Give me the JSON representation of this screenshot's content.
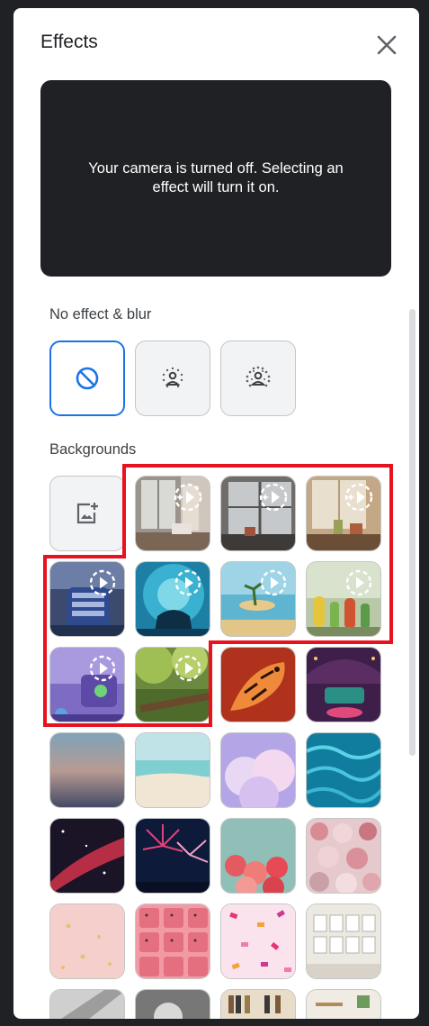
{
  "header": {
    "title": "Effects",
    "close_icon": "close-icon"
  },
  "preview": {
    "message": "Your camera is turned off. Selecting an effect will turn it on."
  },
  "sections": {
    "blur_title": "No effect & blur",
    "backgrounds_title": "Backgrounds"
  },
  "blur_options": [
    {
      "name": "no-effect",
      "icon": "block-icon",
      "selected": true
    },
    {
      "name": "slight-blur",
      "icon": "slight-blur-person-icon",
      "selected": false
    },
    {
      "name": "blur",
      "icon": "blur-person-icon",
      "selected": false
    }
  ],
  "background_items": [
    {
      "name": "add-background",
      "icon": "add-photo-icon"
    },
    {
      "name": "room-window-1",
      "badge": "sparkle-play-icon"
    },
    {
      "name": "room-window-2",
      "badge": "sparkle-play-icon"
    },
    {
      "name": "room-window-3",
      "badge": "sparkle-play-icon"
    },
    {
      "name": "spaceship-seat",
      "badge": "play-icon"
    },
    {
      "name": "underwater",
      "badge": "play-icon"
    },
    {
      "name": "beach-island",
      "badge": "play-icon"
    },
    {
      "name": "classroom-plants",
      "badge": "play-icon"
    },
    {
      "name": "purple-scene",
      "badge": "play-icon"
    },
    {
      "name": "forest-log",
      "badge": "play-icon"
    },
    {
      "name": "tiger"
    },
    {
      "name": "night-venue"
    },
    {
      "name": "sunset-gradient"
    },
    {
      "name": "sandy-beach"
    },
    {
      "name": "pastel-clouds"
    },
    {
      "name": "water-ripples"
    },
    {
      "name": "galaxy"
    },
    {
      "name": "fireworks"
    },
    {
      "name": "pink-flowers"
    },
    {
      "name": "rose-bouquet"
    },
    {
      "name": "pink-bokeh"
    },
    {
      "name": "pink-pattern"
    },
    {
      "name": "confetti"
    },
    {
      "name": "gallery-wall"
    }
  ],
  "colors": {
    "accent": "#1a73e8",
    "highlight": "#e8121f",
    "dark": "#202124"
  }
}
